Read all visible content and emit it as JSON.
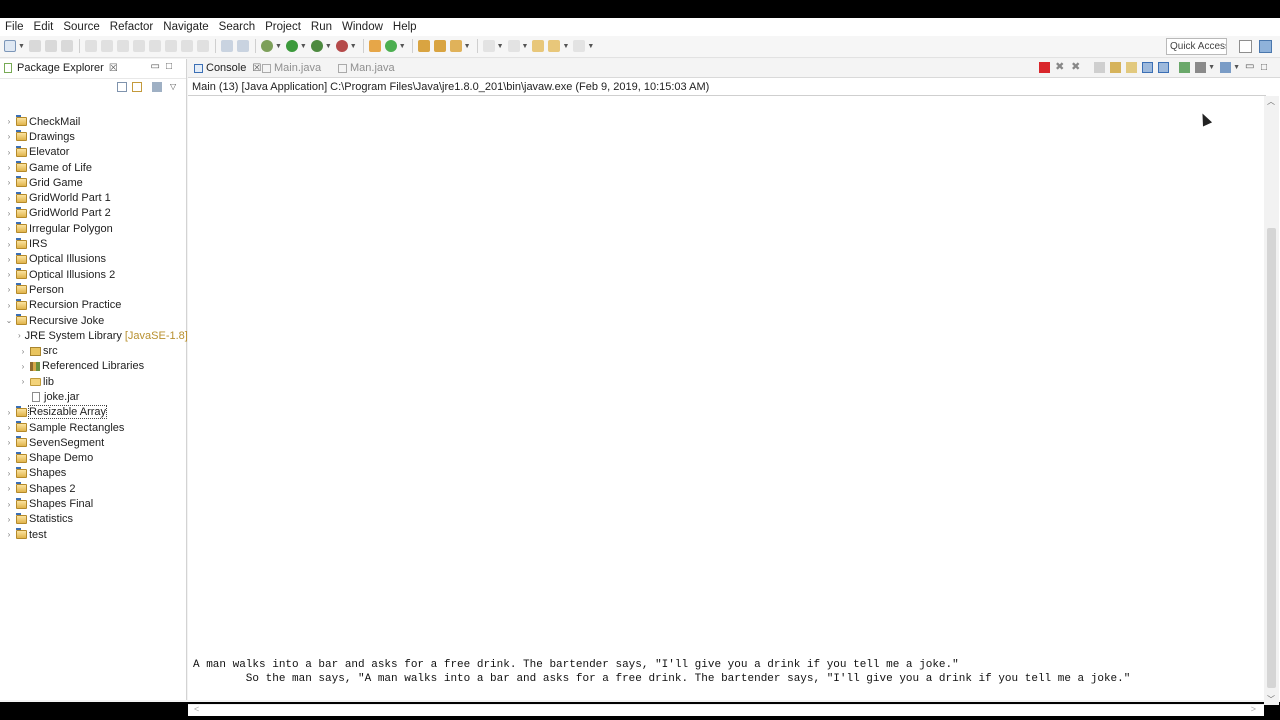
{
  "menu": [
    "File",
    "Edit",
    "Source",
    "Refactor",
    "Navigate",
    "Search",
    "Project",
    "Run",
    "Window",
    "Help"
  ],
  "toolbar": {
    "quick_access": "Quick Access"
  },
  "explorer": {
    "title": "Package Explorer",
    "close": "☒",
    "items": [
      {
        "label": "CheckMail",
        "level": 0,
        "expanded": false,
        "icon": "project-icon"
      },
      {
        "label": "Drawings",
        "level": 0,
        "expanded": false,
        "icon": "project-icon"
      },
      {
        "label": "Elevator",
        "level": 0,
        "expanded": false,
        "icon": "project-icon"
      },
      {
        "label": "Game of Life",
        "level": 0,
        "expanded": false,
        "icon": "project-icon"
      },
      {
        "label": "Grid Game",
        "level": 0,
        "expanded": false,
        "icon": "project-icon"
      },
      {
        "label": "GridWorld Part 1",
        "level": 0,
        "expanded": false,
        "icon": "project-icon"
      },
      {
        "label": "GridWorld Part 2",
        "level": 0,
        "expanded": false,
        "icon": "project-icon"
      },
      {
        "label": "Irregular Polygon",
        "level": 0,
        "expanded": false,
        "icon": "project-icon"
      },
      {
        "label": "IRS",
        "level": 0,
        "expanded": false,
        "icon": "project-icon"
      },
      {
        "label": "Optical Illusions",
        "level": 0,
        "expanded": false,
        "icon": "project-icon"
      },
      {
        "label": "Optical Illusions 2",
        "level": 0,
        "expanded": false,
        "icon": "project-icon"
      },
      {
        "label": "Person",
        "level": 0,
        "expanded": false,
        "icon": "project-icon"
      },
      {
        "label": "Recursion Practice",
        "level": 0,
        "expanded": false,
        "icon": "project-icon"
      },
      {
        "label": "Recursive Joke",
        "level": 0,
        "expanded": true,
        "icon": "project-icon"
      },
      {
        "label": "JRE System Library",
        "decoration": "[JavaSE-1.8]",
        "level": 1,
        "expanded": false,
        "icon": "library-icon"
      },
      {
        "label": "src",
        "level": 1,
        "expanded": false,
        "icon": "package-folder-icon"
      },
      {
        "label": "Referenced Libraries",
        "level": 1,
        "expanded": false,
        "icon": "library-icon"
      },
      {
        "label": "lib",
        "level": 1,
        "expanded": false,
        "icon": "folder-icon"
      },
      {
        "label": "joke.jar",
        "level": 1,
        "leaf": true,
        "icon": "jar-file-icon"
      },
      {
        "label": "Resizable Array",
        "level": 0,
        "expanded": false,
        "icon": "project-icon",
        "selected": true
      },
      {
        "label": "Sample Rectangles",
        "level": 0,
        "expanded": false,
        "icon": "project-icon"
      },
      {
        "label": "SevenSegment",
        "level": 0,
        "expanded": false,
        "icon": "project-icon"
      },
      {
        "label": "Shape Demo",
        "level": 0,
        "expanded": false,
        "icon": "project-icon"
      },
      {
        "label": "Shapes",
        "level": 0,
        "expanded": false,
        "icon": "project-icon"
      },
      {
        "label": "Shapes 2",
        "level": 0,
        "expanded": false,
        "icon": "project-icon"
      },
      {
        "label": "Shapes Final",
        "level": 0,
        "expanded": false,
        "icon": "project-icon"
      },
      {
        "label": "Statistics",
        "level": 0,
        "expanded": false,
        "icon": "project-icon"
      },
      {
        "label": "test",
        "level": 0,
        "expanded": false,
        "icon": "project-icon"
      }
    ]
  },
  "editor_tabs": [
    {
      "label": "Console",
      "close": "☒",
      "active": true
    },
    {
      "label": "Main.java",
      "active": false
    },
    {
      "label": "Man.java",
      "active": false
    }
  ],
  "console": {
    "launch": "Main (13) [Java Application] C:\\Program Files\\Java\\jre1.8.0_201\\bin\\javaw.exe (Feb 9, 2019, 10:15:03 AM)",
    "lines": [
      "A man walks into a bar and asks for a free drink. The bartender says, \"I'll give you a drink if you tell me a joke.\"",
      "        So the man says, \"A man walks into a bar and asks for a free drink. The bartender says, \"I'll give you a drink if you tell me a joke.\""
    ]
  },
  "colors": {
    "terminate": "#d9262b",
    "accent": "#3b6fb5",
    "deco": "#b8902f"
  }
}
